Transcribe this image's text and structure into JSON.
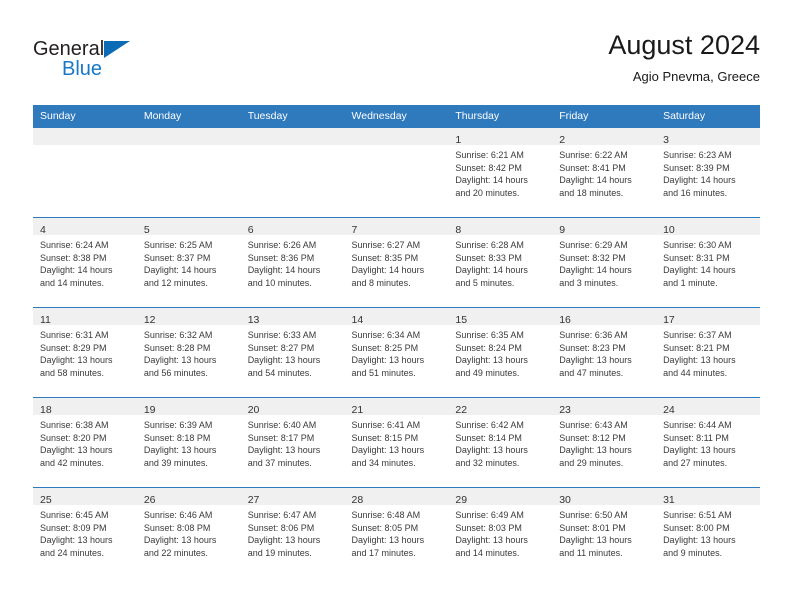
{
  "brand": {
    "name_part1": "General",
    "name_part2": "Blue",
    "accent_color": "#1878c8",
    "triangle_color": "#0b6bb5"
  },
  "header": {
    "title": "August 2024",
    "subtitle": "Agio Pnevma, Greece"
  },
  "theme": {
    "header_bar_color": "#2f79bd",
    "daynum_band_color": "#f0f0f0",
    "grid_line_color": "#2f79bd"
  },
  "weekdays": [
    "Sunday",
    "Monday",
    "Tuesday",
    "Wednesday",
    "Thursday",
    "Friday",
    "Saturday"
  ],
  "labels": {
    "sunrise_prefix": "Sunrise:",
    "sunset_prefix": "Sunset:",
    "daylight_prefix": "Daylight:"
  },
  "weeks": [
    [
      {
        "empty": true
      },
      {
        "empty": true
      },
      {
        "empty": true
      },
      {
        "empty": true
      },
      {
        "day": "1",
        "sunrise": "Sunrise: 6:21 AM",
        "sunset": "Sunset: 8:42 PM",
        "daylight1": "Daylight: 14 hours",
        "daylight2": "and 20 minutes."
      },
      {
        "day": "2",
        "sunrise": "Sunrise: 6:22 AM",
        "sunset": "Sunset: 8:41 PM",
        "daylight1": "Daylight: 14 hours",
        "daylight2": "and 18 minutes."
      },
      {
        "day": "3",
        "sunrise": "Sunrise: 6:23 AM",
        "sunset": "Sunset: 8:39 PM",
        "daylight1": "Daylight: 14 hours",
        "daylight2": "and 16 minutes."
      }
    ],
    [
      {
        "day": "4",
        "sunrise": "Sunrise: 6:24 AM",
        "sunset": "Sunset: 8:38 PM",
        "daylight1": "Daylight: 14 hours",
        "daylight2": "and 14 minutes."
      },
      {
        "day": "5",
        "sunrise": "Sunrise: 6:25 AM",
        "sunset": "Sunset: 8:37 PM",
        "daylight1": "Daylight: 14 hours",
        "daylight2": "and 12 minutes."
      },
      {
        "day": "6",
        "sunrise": "Sunrise: 6:26 AM",
        "sunset": "Sunset: 8:36 PM",
        "daylight1": "Daylight: 14 hours",
        "daylight2": "and 10 minutes."
      },
      {
        "day": "7",
        "sunrise": "Sunrise: 6:27 AM",
        "sunset": "Sunset: 8:35 PM",
        "daylight1": "Daylight: 14 hours",
        "daylight2": "and 8 minutes."
      },
      {
        "day": "8",
        "sunrise": "Sunrise: 6:28 AM",
        "sunset": "Sunset: 8:33 PM",
        "daylight1": "Daylight: 14 hours",
        "daylight2": "and 5 minutes."
      },
      {
        "day": "9",
        "sunrise": "Sunrise: 6:29 AM",
        "sunset": "Sunset: 8:32 PM",
        "daylight1": "Daylight: 14 hours",
        "daylight2": "and 3 minutes."
      },
      {
        "day": "10",
        "sunrise": "Sunrise: 6:30 AM",
        "sunset": "Sunset: 8:31 PM",
        "daylight1": "Daylight: 14 hours",
        "daylight2": "and 1 minute."
      }
    ],
    [
      {
        "day": "11",
        "sunrise": "Sunrise: 6:31 AM",
        "sunset": "Sunset: 8:29 PM",
        "daylight1": "Daylight: 13 hours",
        "daylight2": "and 58 minutes."
      },
      {
        "day": "12",
        "sunrise": "Sunrise: 6:32 AM",
        "sunset": "Sunset: 8:28 PM",
        "daylight1": "Daylight: 13 hours",
        "daylight2": "and 56 minutes."
      },
      {
        "day": "13",
        "sunrise": "Sunrise: 6:33 AM",
        "sunset": "Sunset: 8:27 PM",
        "daylight1": "Daylight: 13 hours",
        "daylight2": "and 54 minutes."
      },
      {
        "day": "14",
        "sunrise": "Sunrise: 6:34 AM",
        "sunset": "Sunset: 8:25 PM",
        "daylight1": "Daylight: 13 hours",
        "daylight2": "and 51 minutes."
      },
      {
        "day": "15",
        "sunrise": "Sunrise: 6:35 AM",
        "sunset": "Sunset: 8:24 PM",
        "daylight1": "Daylight: 13 hours",
        "daylight2": "and 49 minutes."
      },
      {
        "day": "16",
        "sunrise": "Sunrise: 6:36 AM",
        "sunset": "Sunset: 8:23 PM",
        "daylight1": "Daylight: 13 hours",
        "daylight2": "and 47 minutes."
      },
      {
        "day": "17",
        "sunrise": "Sunrise: 6:37 AM",
        "sunset": "Sunset: 8:21 PM",
        "daylight1": "Daylight: 13 hours",
        "daylight2": "and 44 minutes."
      }
    ],
    [
      {
        "day": "18",
        "sunrise": "Sunrise: 6:38 AM",
        "sunset": "Sunset: 8:20 PM",
        "daylight1": "Daylight: 13 hours",
        "daylight2": "and 42 minutes."
      },
      {
        "day": "19",
        "sunrise": "Sunrise: 6:39 AM",
        "sunset": "Sunset: 8:18 PM",
        "daylight1": "Daylight: 13 hours",
        "daylight2": "and 39 minutes."
      },
      {
        "day": "20",
        "sunrise": "Sunrise: 6:40 AM",
        "sunset": "Sunset: 8:17 PM",
        "daylight1": "Daylight: 13 hours",
        "daylight2": "and 37 minutes."
      },
      {
        "day": "21",
        "sunrise": "Sunrise: 6:41 AM",
        "sunset": "Sunset: 8:15 PM",
        "daylight1": "Daylight: 13 hours",
        "daylight2": "and 34 minutes."
      },
      {
        "day": "22",
        "sunrise": "Sunrise: 6:42 AM",
        "sunset": "Sunset: 8:14 PM",
        "daylight1": "Daylight: 13 hours",
        "daylight2": "and 32 minutes."
      },
      {
        "day": "23",
        "sunrise": "Sunrise: 6:43 AM",
        "sunset": "Sunset: 8:12 PM",
        "daylight1": "Daylight: 13 hours",
        "daylight2": "and 29 minutes."
      },
      {
        "day": "24",
        "sunrise": "Sunrise: 6:44 AM",
        "sunset": "Sunset: 8:11 PM",
        "daylight1": "Daylight: 13 hours",
        "daylight2": "and 27 minutes."
      }
    ],
    [
      {
        "day": "25",
        "sunrise": "Sunrise: 6:45 AM",
        "sunset": "Sunset: 8:09 PM",
        "daylight1": "Daylight: 13 hours",
        "daylight2": "and 24 minutes."
      },
      {
        "day": "26",
        "sunrise": "Sunrise: 6:46 AM",
        "sunset": "Sunset: 8:08 PM",
        "daylight1": "Daylight: 13 hours",
        "daylight2": "and 22 minutes."
      },
      {
        "day": "27",
        "sunrise": "Sunrise: 6:47 AM",
        "sunset": "Sunset: 8:06 PM",
        "daylight1": "Daylight: 13 hours",
        "daylight2": "and 19 minutes."
      },
      {
        "day": "28",
        "sunrise": "Sunrise: 6:48 AM",
        "sunset": "Sunset: 8:05 PM",
        "daylight1": "Daylight: 13 hours",
        "daylight2": "and 17 minutes."
      },
      {
        "day": "29",
        "sunrise": "Sunrise: 6:49 AM",
        "sunset": "Sunset: 8:03 PM",
        "daylight1": "Daylight: 13 hours",
        "daylight2": "and 14 minutes."
      },
      {
        "day": "30",
        "sunrise": "Sunrise: 6:50 AM",
        "sunset": "Sunset: 8:01 PM",
        "daylight1": "Daylight: 13 hours",
        "daylight2": "and 11 minutes."
      },
      {
        "day": "31",
        "sunrise": "Sunrise: 6:51 AM",
        "sunset": "Sunset: 8:00 PM",
        "daylight1": "Daylight: 13 hours",
        "daylight2": "and 9 minutes."
      }
    ]
  ]
}
